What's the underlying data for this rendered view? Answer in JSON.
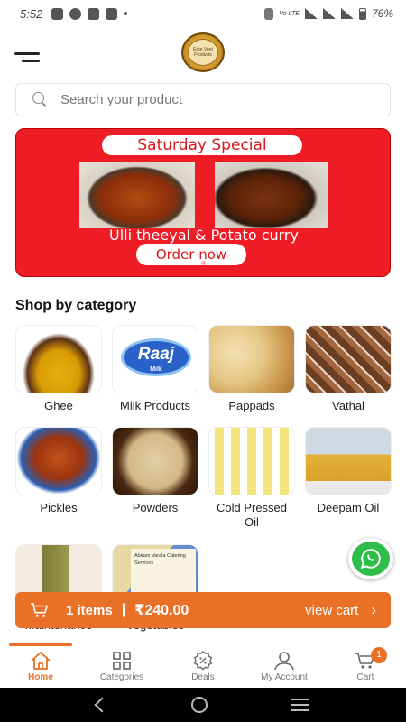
{
  "status_bar": {
    "time": "5:52",
    "network": "Vo LTE",
    "battery": "76%"
  },
  "logo": {
    "text": "Ente Veet Products"
  },
  "search": {
    "placeholder": "Search your product"
  },
  "banner": {
    "title": "Saturday Special",
    "subtitle": "Ulli theeyal & Potato curry",
    "button": "Order now"
  },
  "categories_section": {
    "title": "Shop by category",
    "items": [
      {
        "label": "Ghee"
      },
      {
        "label": "Milk Products",
        "brand": "Raaj",
        "brand_sub": "Milk"
      },
      {
        "label": "Pappads"
      },
      {
        "label": "Vathal"
      },
      {
        "label": "Pickles"
      },
      {
        "label": "Powders"
      },
      {
        "label": "Cold Pressed Oil"
      },
      {
        "label": "Deepam Oil"
      },
      {
        "label": "Maintenance"
      },
      {
        "label": "Vegetables",
        "card_text": "Abiram Varala Catering Services"
      }
    ]
  },
  "cart_bar": {
    "items": "1 items",
    "total": "₹240.00",
    "action": "view cart"
  },
  "bottom_nav": {
    "items": [
      {
        "label": "Home",
        "active": true
      },
      {
        "label": "Categories"
      },
      {
        "label": "Deals"
      },
      {
        "label": "My Account"
      },
      {
        "label": "Cart",
        "badge": "1"
      }
    ]
  },
  "colors": {
    "accent": "#e97127",
    "banner": "#ee1c24",
    "whatsapp": "#2fbd49"
  }
}
